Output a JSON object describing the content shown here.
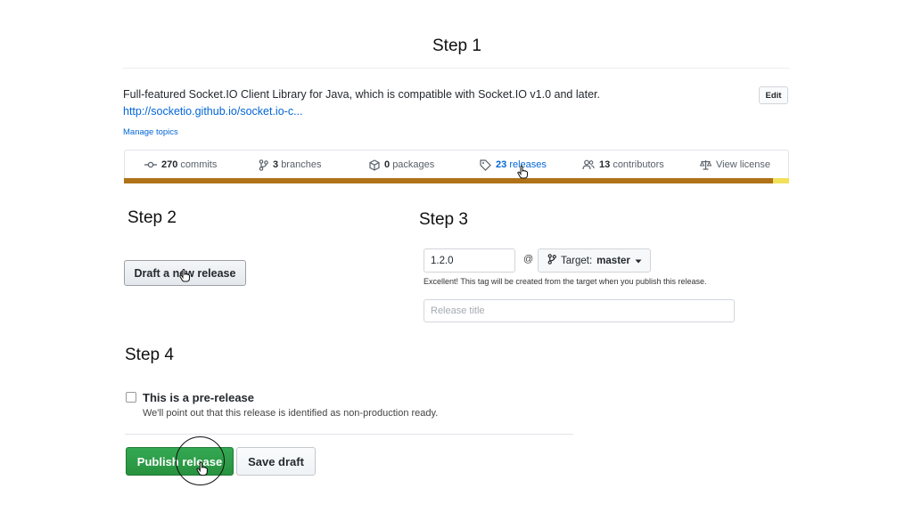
{
  "steps": {
    "step1": "Step 1",
    "step2": "Step 2",
    "step3": "Step 3",
    "step4": "Step 4"
  },
  "repo": {
    "description": "Full-featured Socket.IO Client Library for Java, which is compatible with Socket.IO v1.0 and later.",
    "link": "http://socketio.github.io/socket.io-c...",
    "manage_topics": "Manage topics",
    "edit_label": "Edit"
  },
  "summary": {
    "commits_count": "270",
    "commits_label": "commits",
    "branches_count": "3",
    "branches_label": "branches",
    "packages_count": "0",
    "packages_label": "packages",
    "releases_count": "23",
    "releases_label": "releases",
    "contributors_count": "13",
    "contributors_label": "contributors",
    "license_label": "View license"
  },
  "language_bar": {
    "colors": [
      "#b07219",
      "#f1e05a"
    ]
  },
  "draft": {
    "button_label": "Draft a new release"
  },
  "release_form": {
    "tag_value": "1.2.0",
    "at_sign": "@",
    "target_prefix": "Target:",
    "target_branch": "master",
    "tag_help": "Excellent! This tag will be created from the target when you publish this release.",
    "title_placeholder": "Release title"
  },
  "prerelease": {
    "label": "This is a pre-release",
    "note": "We'll point out that this release is identified as non-production ready."
  },
  "actions": {
    "publish_label": "Publish release",
    "save_draft_label": "Save draft"
  },
  "colors": {
    "link": "#0366d6",
    "publish_green": "#2ea44f"
  }
}
